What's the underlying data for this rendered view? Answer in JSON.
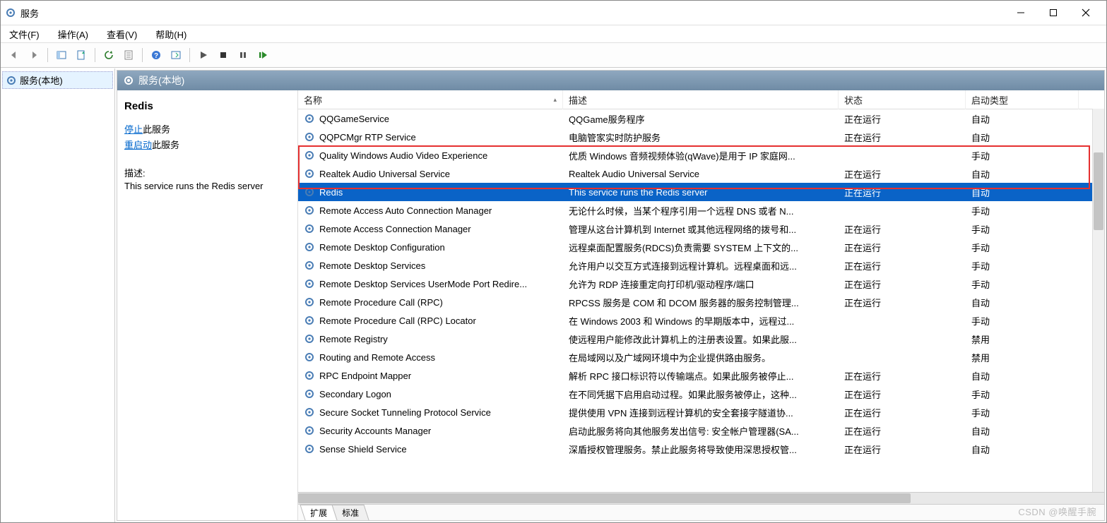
{
  "window": {
    "title": "服务"
  },
  "menus": {
    "file": "文件(F)",
    "action": "操作(A)",
    "view": "查看(V)",
    "help": "帮助(H)"
  },
  "tree": {
    "root": "服务(本地)"
  },
  "panel": {
    "title": "服务(本地)"
  },
  "detail": {
    "selected_name": "Redis",
    "stop_link": "停止",
    "stop_suffix": "此服务",
    "restart_link": "重启动",
    "restart_suffix": "此服务",
    "desc_label": "描述:",
    "desc_text": "This service runs the Redis server"
  },
  "columns": {
    "name": "名称",
    "desc": "描述",
    "status": "状态",
    "startup": "启动类型"
  },
  "tabs": {
    "extended": "扩展",
    "standard": "标准"
  },
  "watermark": "CSDN @唤醒手腕",
  "services": [
    {
      "name": "QQGameService",
      "desc": "QQGame服务程序",
      "status": "正在运行",
      "startup": "自动"
    },
    {
      "name": "QQPCMgr RTP Service",
      "desc": "电脑管家实时防护服务",
      "status": "正在运行",
      "startup": "自动"
    },
    {
      "name": "Quality Windows Audio Video Experience",
      "desc": "优质 Windows 音频视频体验(qWave)是用于 IP 家庭网...",
      "status": "",
      "startup": "手动"
    },
    {
      "name": "Realtek Audio Universal Service",
      "desc": "Realtek Audio Universal Service",
      "status": "正在运行",
      "startup": "自动"
    },
    {
      "name": "Redis",
      "desc": "This service runs the Redis server",
      "status": "正在运行",
      "startup": "自动",
      "selected": true
    },
    {
      "name": "Remote Access Auto Connection Manager",
      "desc": "无论什么时候，当某个程序引用一个远程 DNS 或者 N...",
      "status": "",
      "startup": "手动"
    },
    {
      "name": "Remote Access Connection Manager",
      "desc": "管理从这台计算机到 Internet 或其他远程网络的拨号和...",
      "status": "正在运行",
      "startup": "手动"
    },
    {
      "name": "Remote Desktop Configuration",
      "desc": "远程桌面配置服务(RDCS)负责需要 SYSTEM 上下文的...",
      "status": "正在运行",
      "startup": "手动"
    },
    {
      "name": "Remote Desktop Services",
      "desc": "允许用户以交互方式连接到远程计算机。远程桌面和远...",
      "status": "正在运行",
      "startup": "手动"
    },
    {
      "name": "Remote Desktop Services UserMode Port Redire...",
      "desc": "允许为 RDP 连接重定向打印机/驱动程序/端口",
      "status": "正在运行",
      "startup": "手动"
    },
    {
      "name": "Remote Procedure Call (RPC)",
      "desc": "RPCSS 服务是 COM 和 DCOM 服务器的服务控制管理...",
      "status": "正在运行",
      "startup": "自动"
    },
    {
      "name": "Remote Procedure Call (RPC) Locator",
      "desc": "在 Windows 2003 和 Windows 的早期版本中，远程过...",
      "status": "",
      "startup": "手动"
    },
    {
      "name": "Remote Registry",
      "desc": "使远程用户能修改此计算机上的注册表设置。如果此服...",
      "status": "",
      "startup": "禁用"
    },
    {
      "name": "Routing and Remote Access",
      "desc": "在局域网以及广域网环境中为企业提供路由服务。",
      "status": "",
      "startup": "禁用"
    },
    {
      "name": "RPC Endpoint Mapper",
      "desc": "解析 RPC 接口标识符以传输端点。如果此服务被停止...",
      "status": "正在运行",
      "startup": "自动"
    },
    {
      "name": "Secondary Logon",
      "desc": "在不同凭据下启用启动过程。如果此服务被停止，这种...",
      "status": "正在运行",
      "startup": "手动"
    },
    {
      "name": "Secure Socket Tunneling Protocol Service",
      "desc": "提供使用 VPN 连接到远程计算机的安全套接字隧道协...",
      "status": "正在运行",
      "startup": "手动"
    },
    {
      "name": "Security Accounts Manager",
      "desc": "启动此服务将向其他服务发出信号: 安全帐户管理器(SA...",
      "status": "正在运行",
      "startup": "自动"
    },
    {
      "name": "Sense Shield Service",
      "desc": "深盾授权管理服务。禁止此服务将导致使用深思授权管...",
      "status": "正在运行",
      "startup": "自动"
    }
  ]
}
